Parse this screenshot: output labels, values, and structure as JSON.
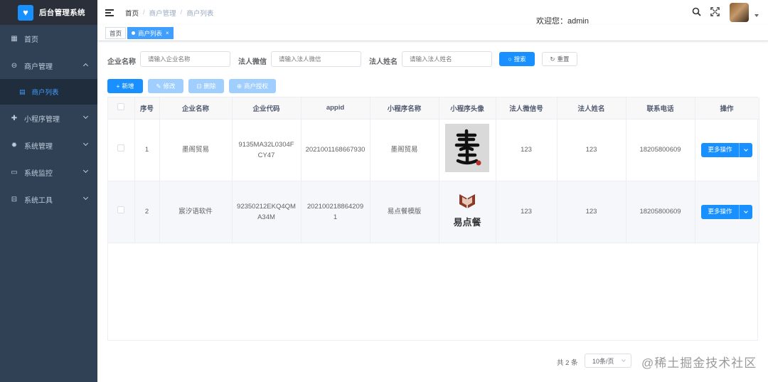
{
  "app": {
    "title": "后台管理系统"
  },
  "sidebar": {
    "items": [
      {
        "label": "首页",
        "icon": "dashboard-icon"
      },
      {
        "label": "商户管理",
        "icon": "merchant-icon",
        "expanded": true,
        "children": [
          {
            "label": "商户列表",
            "icon": "list-icon"
          }
        ]
      },
      {
        "label": "小程序管理",
        "icon": "miniapp-icon"
      },
      {
        "label": "系统管理",
        "icon": "gear-icon"
      },
      {
        "label": "系统监控",
        "icon": "monitor-icon"
      },
      {
        "label": "系统工具",
        "icon": "toolbox-icon"
      }
    ]
  },
  "header": {
    "breadcrumb": [
      "首页",
      "商户管理",
      "商户列表"
    ],
    "welcome": "欢迎您：admin"
  },
  "tags": [
    {
      "label": "首页"
    },
    {
      "label": "商户列表",
      "active": true
    }
  ],
  "search": {
    "company_label": "企业名称",
    "company_placeholder": "请输入企业名称",
    "wechat_label": "法人微信",
    "wechat_placeholder": "请输入法人微信",
    "name_label": "法人姓名",
    "name_placeholder": "请输入法人姓名",
    "search_button": "搜索",
    "reset_button": "重置"
  },
  "toolbar": {
    "add": "新增",
    "edit": "修改",
    "delete": "删除",
    "authorize": "商户授权"
  },
  "table": {
    "columns": [
      "",
      "序号",
      "企业名称",
      "企业代码",
      "appid",
      "小程序名称",
      "小程序头像",
      "法人微信号",
      "法人姓名",
      "联系电话",
      "操作"
    ],
    "rows": [
      {
        "index": "1",
        "company": "墨阁贸易",
        "code": "9135MA32L0304FCY47",
        "appid": "2021001168667930",
        "miniapp": "墨阁贸易",
        "wechat": "123",
        "legal_name": "123",
        "phone": "18205800609",
        "action": "更多操作"
      },
      {
        "index": "2",
        "company": "宸汐语软件",
        "code": "92350212EKQ4QMA34M",
        "appid": "2021002188642091",
        "miniapp": "易点餐模版",
        "wechat": "123",
        "legal_name": "123",
        "phone": "18205800609",
        "action": "更多操作"
      }
    ],
    "row2_logo_text": "易点餐"
  },
  "pagination": {
    "total": "共 2 条",
    "page_size": "10条/页"
  },
  "watermark": "@稀土掘金技术社区",
  "colors": {
    "sidebar": "#304156",
    "primary": "#1890ff",
    "logo_bar": "#2b2f3a"
  }
}
